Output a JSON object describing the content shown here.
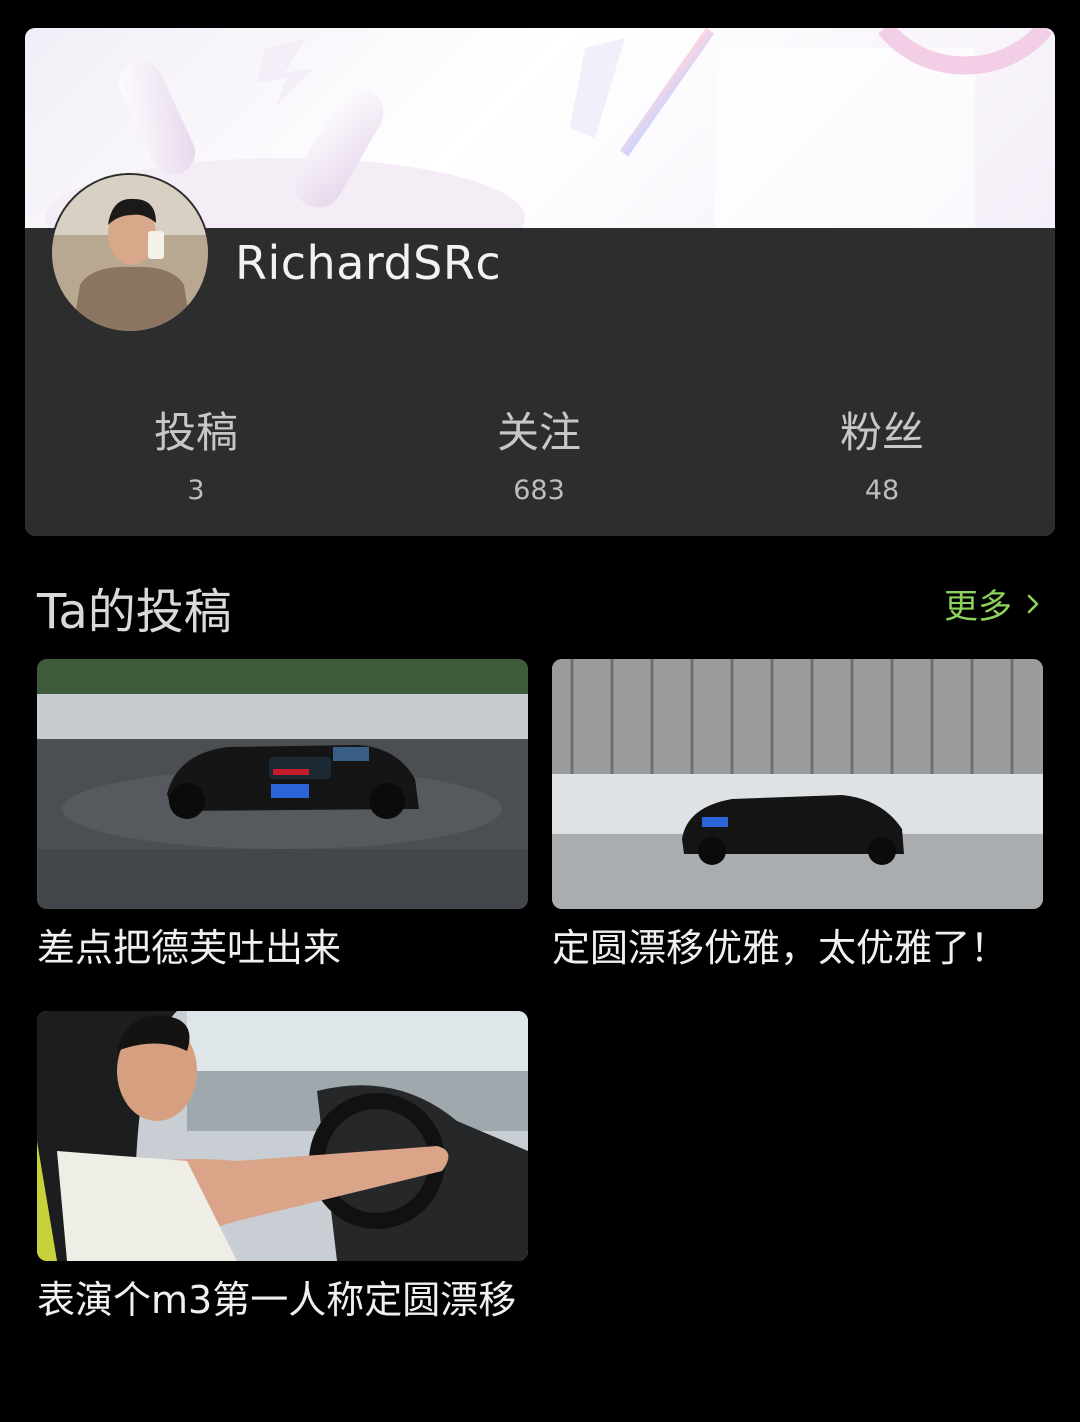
{
  "profile": {
    "username": "RichardSRc",
    "stats": [
      {
        "label": "投稿",
        "value": "3"
      },
      {
        "label": "关注",
        "value": "683"
      },
      {
        "label": "粉丝",
        "value": "48"
      }
    ]
  },
  "posts_section": {
    "title": "Ta的投稿",
    "more_label": "更多"
  },
  "posts": [
    {
      "title": "差点把德芙吐出来"
    },
    {
      "title": "定圆漂移优雅，太优雅了！"
    },
    {
      "title": "表演个m3第一人称定圆漂移"
    }
  ],
  "colors": {
    "background": "#000000",
    "card": "#2d2d2d",
    "accent": "#8bd35b"
  }
}
